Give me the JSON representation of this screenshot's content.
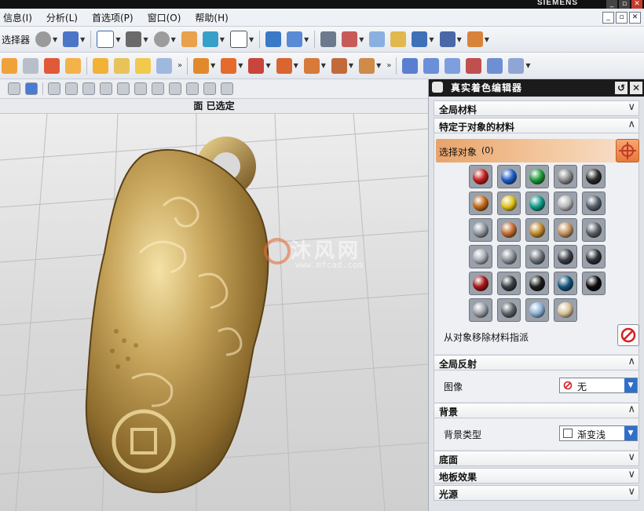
{
  "window": {
    "brand": "SIEMENS",
    "buttons": {
      "minimize": "_",
      "restore": "▫",
      "close": "✕"
    }
  },
  "menubar": {
    "items": [
      {
        "label": "信息(I)"
      },
      {
        "label": "分析(L)"
      },
      {
        "label": "首选项(P)"
      },
      {
        "label": "窗口(O)"
      },
      {
        "label": "帮助(H)"
      }
    ],
    "mdi": {
      "minimize": "_",
      "restore": "▫",
      "close": "✕"
    }
  },
  "toolbar1": {
    "cut_label": "选择器"
  },
  "viewport": {
    "header": "面 已选定"
  },
  "watermark": {
    "main": "沐风网",
    "url": "www.mfcad.com"
  },
  "panel": {
    "title": "真实着色编辑器",
    "sections": {
      "global_materials": "全局材料",
      "object_materials": "特定于对象的材料",
      "global_reflection": "全局反射",
      "background": "背景",
      "floor": "底面",
      "floor_effects": "地板效果",
      "lights": "光源"
    },
    "select_object": {
      "label": "选择对象",
      "count": "(0)"
    },
    "remove_label": "从对象移除材料指派",
    "image": {
      "label": "图像",
      "value": "无"
    },
    "background_type": {
      "label": "背景类型",
      "value": "渐变浅"
    },
    "materials": [
      "#c41f1f",
      "#1f5fc9",
      "#1f9a3a",
      "#8c8c8c",
      "#2a2a2a",
      "#c26a1c",
      "#e3c21a",
      "#139a8a",
      "#b9b9b9",
      "#55606b",
      "#9097a0",
      "#c46d34",
      "#c48a2e",
      "#c49560",
      "#5c6066",
      "#a8aeb5",
      "#8d9399",
      "#70757b",
      "#3c4046",
      "#2d3136",
      "#a51616",
      "#3b3f44",
      "#1d1d1d",
      "#15527a",
      "#0b0b0b",
      "#9aa0a7",
      "#5d6268",
      "#8fb4d9",
      "#d8c49a"
    ]
  }
}
